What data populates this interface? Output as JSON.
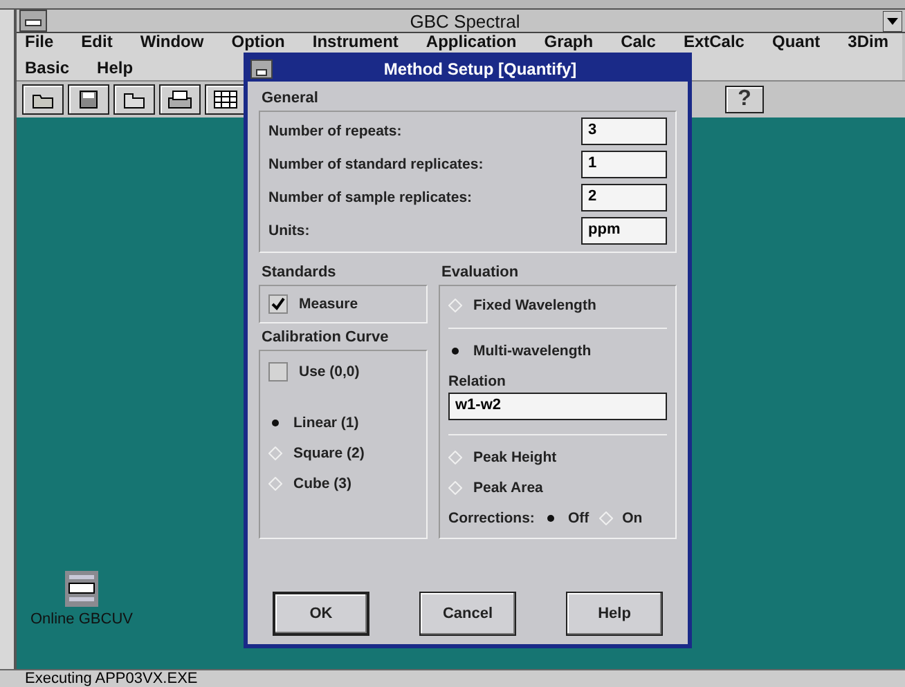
{
  "window": {
    "title": "GBC Spectral"
  },
  "menus": [
    "File",
    "Edit",
    "Window",
    "Option",
    "Instrument",
    "Application",
    "Graph",
    "Calc",
    "ExtCalc",
    "Quant",
    "3Dim",
    "Basic",
    "Help"
  ],
  "toolbar": {
    "help_button": "?"
  },
  "desktop": {
    "icon_label": "Online GBCUV"
  },
  "status_bar": "Executing APP03VX.EXE",
  "dialog": {
    "title": "Method Setup [Quantify]",
    "general": {
      "label": "General",
      "fields": [
        {
          "label": "Number of repeats:",
          "value": "3"
        },
        {
          "label": "Number of standard replicates:",
          "value": "1"
        },
        {
          "label": "Number of sample replicates:",
          "value": "2"
        },
        {
          "label": "Units:",
          "value": "ppm"
        }
      ]
    },
    "standards": {
      "label": "Standards",
      "checkbox": {
        "label": "Measure",
        "checked": true
      }
    },
    "calibration": {
      "label": "Calibration Curve",
      "use_origin": {
        "label": "Use (0,0)",
        "checked": false
      },
      "options": [
        {
          "label": "Linear (1)",
          "selected": true
        },
        {
          "label": "Square (2)",
          "selected": false
        },
        {
          "label": "Cube (3)",
          "selected": false
        }
      ]
    },
    "evaluation": {
      "label": "Evaluation",
      "modes": [
        {
          "label": "Fixed Wavelength",
          "selected": false
        },
        {
          "label": "Multi-wavelength",
          "selected": true
        }
      ],
      "relation": {
        "label": "Relation",
        "value": "w1-w2"
      },
      "measures": [
        {
          "label": "Peak Height",
          "selected": false
        },
        {
          "label": "Peak Area",
          "selected": false
        }
      ],
      "corrections": {
        "label": "Corrections:",
        "options": [
          {
            "label": "Off",
            "selected": true
          },
          {
            "label": "On",
            "selected": false
          }
        ]
      }
    },
    "buttons": [
      "OK",
      "Cancel",
      "Help"
    ]
  }
}
